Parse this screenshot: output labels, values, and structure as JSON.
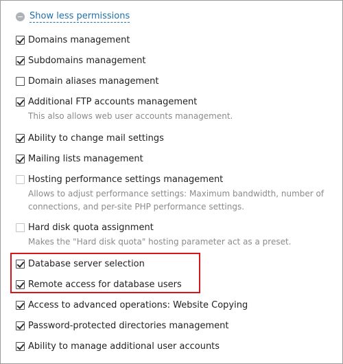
{
  "toggle": {
    "label": "Show less permissions"
  },
  "highlight_color": "#d9151b",
  "permissions": [
    {
      "label": "Domains management",
      "checked": true,
      "disabled": false
    },
    {
      "label": "Subdomains management",
      "checked": true,
      "disabled": false
    },
    {
      "label": "Domain aliases management",
      "checked": false,
      "disabled": false
    },
    {
      "label": "Additional FTP accounts management",
      "checked": true,
      "disabled": false,
      "description": "This also allows web user accounts management."
    },
    {
      "label": "Ability to change mail settings",
      "checked": true,
      "disabled": false
    },
    {
      "label": "Mailing lists management",
      "checked": true,
      "disabled": false
    },
    {
      "label": "Hosting performance settings management",
      "checked": false,
      "disabled": true,
      "description": "Allows to adjust performance settings: Maximum bandwidth, number of connections, and per-site PHP performance settings."
    },
    {
      "label": "Hard disk quota assignment",
      "checked": false,
      "disabled": true,
      "description": "Makes the \"Hard disk quota\" hosting parameter act as a preset."
    },
    {
      "label": "Database server selection",
      "checked": true,
      "disabled": false
    },
    {
      "label": "Remote access for database users",
      "checked": true,
      "disabled": false
    },
    {
      "label": "Access to advanced operations: Website Copying",
      "checked": true,
      "disabled": false
    },
    {
      "label": "Password-protected directories management",
      "checked": true,
      "disabled": false
    },
    {
      "label": "Ability to manage additional user accounts",
      "checked": true,
      "disabled": false
    }
  ]
}
